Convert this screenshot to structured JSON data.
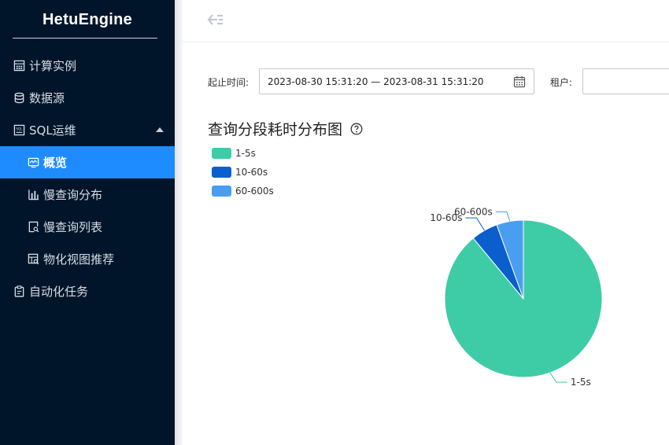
{
  "app": {
    "brand": "HetuEngine"
  },
  "sidebar": {
    "items": [
      {
        "label": "计算实例",
        "icon": "calculator-icon",
        "level": 1,
        "active": false
      },
      {
        "label": "数据源",
        "icon": "database-icon",
        "level": 1,
        "active": false
      },
      {
        "label": "SQL运维",
        "icon": "sql-icon",
        "level": 1,
        "active": false,
        "expanded": true
      },
      {
        "label": "概览",
        "icon": "monitor-icon",
        "level": 2,
        "active": true
      },
      {
        "label": "慢查询分布",
        "icon": "bar-chart-icon",
        "level": 2,
        "active": false
      },
      {
        "label": "慢查询列表",
        "icon": "search-doc-icon",
        "level": 2,
        "active": false
      },
      {
        "label": "物化视图推荐",
        "icon": "view-search-icon",
        "level": 2,
        "active": false
      },
      {
        "label": "自动化任务",
        "icon": "clipboard-icon",
        "level": 1,
        "active": false
      }
    ]
  },
  "filters": {
    "time_label": "起止时间:",
    "time_value": "2023-08-30 15:31:20 — 2023-08-31 15:31:20",
    "tenant_label": "租户:",
    "tenant_value": ""
  },
  "chart_data": {
    "type": "pie",
    "title": "查询分段耗时分布图",
    "categories": [
      "1-5s",
      "10-60s",
      "60-600s"
    ],
    "values": [
      89,
      5.5,
      5.5
    ],
    "colors": [
      "#3ecca6",
      "#0a5fcc",
      "#4a9ef0"
    ],
    "legend": "top-left"
  }
}
